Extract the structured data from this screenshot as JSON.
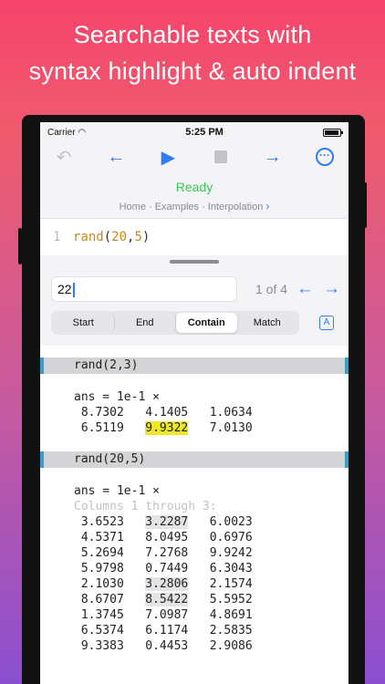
{
  "headline": {
    "line1": "Searchable texts with",
    "line2": "syntax highlight & auto indent"
  },
  "status_bar": {
    "carrier": "Carrier",
    "time": "5:25 PM"
  },
  "toolbar": {
    "undo_icon": "undo-icon",
    "back_icon": "arrow-left-icon",
    "run_icon": "play-icon",
    "stop_icon": "stop-icon",
    "forward_icon": "arrow-right-icon",
    "more_icon": "ellipsis-circle-icon",
    "accent": "#2f7cf6"
  },
  "status": {
    "text": "Ready",
    "color": "#39c45a",
    "breadcrumb": [
      "Home",
      "Examples",
      "Interpolation"
    ]
  },
  "editor": {
    "line_number": "1",
    "code": "rand(20,5)"
  },
  "find": {
    "query": "22",
    "count_text": "1 of 4",
    "modes": [
      "Start",
      "End",
      "Contain",
      "Match"
    ],
    "active_mode": "Contain",
    "case_button": "A"
  },
  "console": {
    "block1": {
      "command": "rand(2,3)",
      "ans": "ans = 1e-1 ×",
      "rows": [
        [
          "8.7302",
          "4.1405",
          "1.0634"
        ],
        [
          "6.5119",
          "9.9322",
          "7.0130"
        ]
      ]
    },
    "block2": {
      "command": "rand(20,5)",
      "ans": "ans = 1e-1 ×",
      "columns_note": "Columns 1 through 3:",
      "rows": [
        [
          "3.6523",
          "3.2287",
          "6.0023"
        ],
        [
          "4.5371",
          "8.0495",
          "0.6976"
        ],
        [
          "5.2694",
          "7.2768",
          "9.9242"
        ],
        [
          "5.9798",
          "0.7449",
          "6.3043"
        ],
        [
          "2.1030",
          "3.2806",
          "2.1574"
        ],
        [
          "8.6707",
          "8.5422",
          "5.5952"
        ],
        [
          "1.3745",
          "7.0987",
          "4.8691"
        ],
        [
          "6.5374",
          "6.1174",
          "2.5835"
        ],
        [
          "9.3383",
          "0.4453",
          "2.9086"
        ]
      ]
    }
  }
}
